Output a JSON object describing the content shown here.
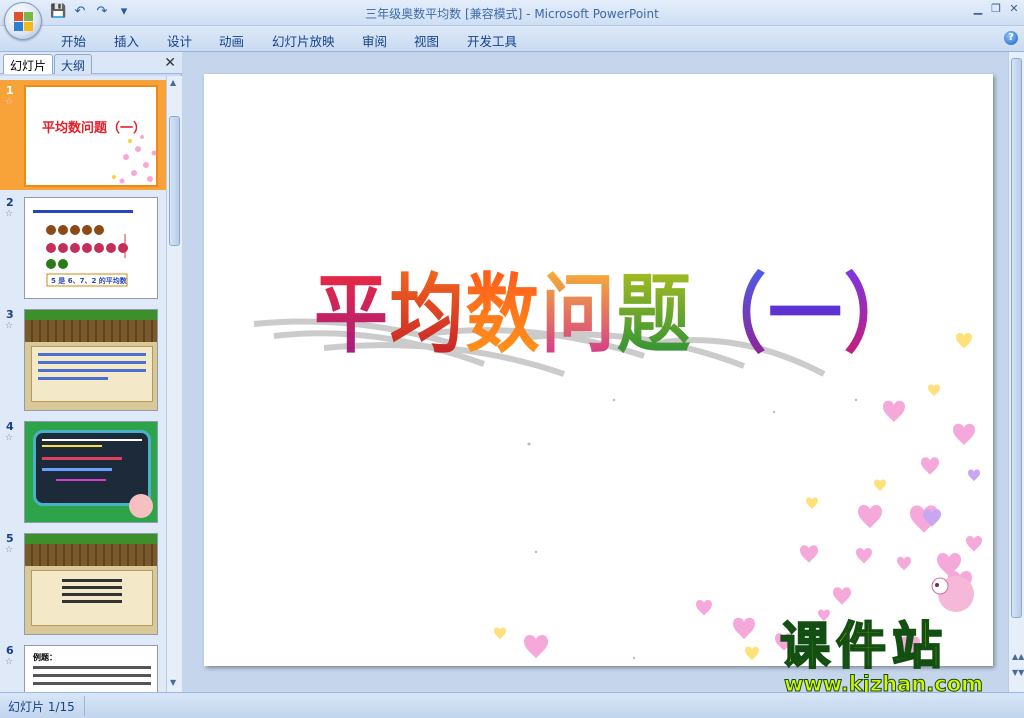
{
  "window": {
    "title": "三年级奥数平均数 [兼容模式]",
    "app_suffix": " - Microsoft PowerPoint",
    "min": "▁",
    "restore": "❐",
    "close": "✕"
  },
  "qat": {
    "save": "💾",
    "undo": "↶",
    "redo": "↷",
    "more": "▾"
  },
  "ribbon": {
    "tabs": [
      "开始",
      "插入",
      "设计",
      "动画",
      "幻灯片放映",
      "审阅",
      "视图",
      "开发工具"
    ],
    "help": "?"
  },
  "panel": {
    "tab_slides": "幻灯片",
    "tab_outline": "大纲",
    "close": "✕",
    "thumbnails": [
      {
        "num": "1",
        "anim": "☆",
        "title": "平均数问题（一）"
      },
      {
        "num": "2",
        "anim": "☆",
        "caption": "5 是 6、7、2 的平均数"
      },
      {
        "num": "3",
        "anim": "☆"
      },
      {
        "num": "4",
        "anim": "☆"
      },
      {
        "num": "5",
        "anim": "☆"
      },
      {
        "num": "6",
        "anim": "☆",
        "heading": "例题："
      }
    ]
  },
  "slide": {
    "title": "平均数问题（一）"
  },
  "status": {
    "slide_index": "幻灯片 1/15"
  },
  "watermark": {
    "big": "课件站",
    "small": "www.kjzhan.com"
  },
  "colors": {
    "accent": "#f8a23a",
    "ribbon": "#dde9f8",
    "panel": "#c8daf2"
  }
}
